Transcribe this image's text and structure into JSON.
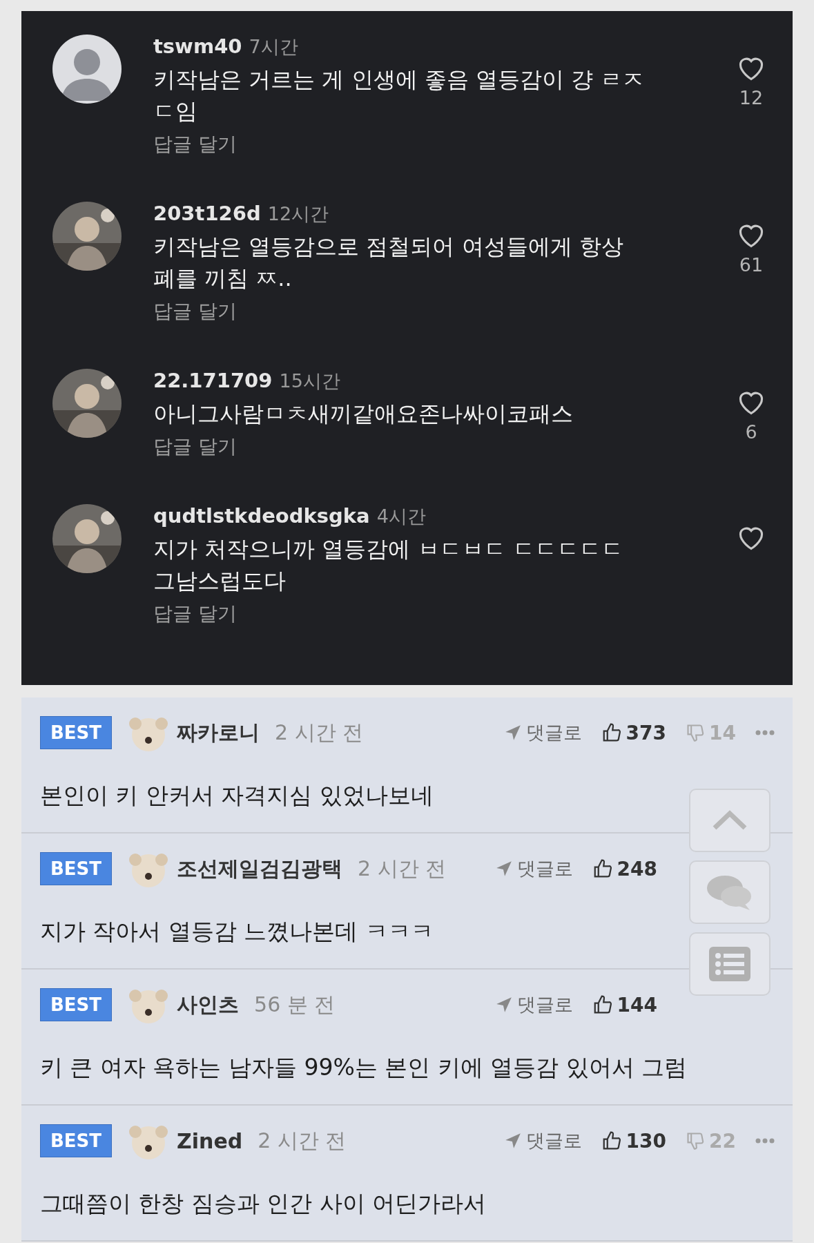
{
  "comments": [
    {
      "kind": "icon",
      "user": "tswm40",
      "time": "7시간",
      "text": "키작남은 거르는 게 인생에 좋음 열등감이 걍 ㄹㅈㄷ임",
      "reply": "답글 달기",
      "likes": "12"
    },
    {
      "kind": "picture",
      "user": "203t126d",
      "time": "12시간",
      "text": "키작남은 열등감으로 점철되어 여성들에게 항상 폐를 끼침 ㅉ..",
      "reply": "답글 달기",
      "likes": "61"
    },
    {
      "kind": "picture",
      "user": "22.171709",
      "time": "15시간",
      "text": "아니그사람ㅁㅊ새끼같애요존나싸이코패스",
      "reply": "답글 달기",
      "likes": "6"
    },
    {
      "kind": "picture",
      "user": "qudtlstkdeodksgka",
      "time": "4시간",
      "text": "지가 처작으니까 열등감에 ㅂㄷㅂㄷ ㄷㄷㄷㄷㄷ 그남스럽도다",
      "reply": "답글 달기"
    }
  ],
  "best_comments": [
    {
      "badge": "BEST",
      "user": "짜카로니",
      "time": "2 시간 전",
      "reply": "댓글로",
      "likes": "373",
      "dislikes": "14",
      "text": "본인이 키 안커서 자격지심 있었나보네"
    },
    {
      "badge": "BEST",
      "user": "조선제일검김광택",
      "time": "2 시간 전",
      "reply": "댓글로",
      "likes": "248",
      "text": "지가 작아서 열등감 느꼈나본데 ㅋㅋㅋ"
    },
    {
      "badge": "BEST",
      "user": "사인츠",
      "time": "56 분 전",
      "reply": "댓글로",
      "likes": "144",
      "text": "키 큰 여자 욕하는 남자들 99%는 본인 키에 열등감 있어서 그럼"
    },
    {
      "badge": "BEST",
      "user": "Zined",
      "time": "2 시간 전",
      "reply": "댓글로",
      "likes": "130",
      "dislikes": "22",
      "text": "그때쯤이 한창 짐승과 인간 사이 어딘가라서"
    }
  ]
}
